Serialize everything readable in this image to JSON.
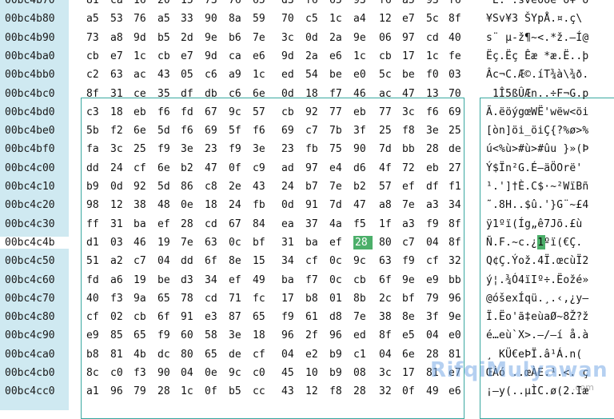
{
  "rows": [
    {
      "offset": "00bc4b70",
      "hex": [
        "81",
        "ca",
        "16",
        "20",
        "15",
        "73",
        "76",
        "65",
        "d3",
        "f6",
        "65",
        "93",
        "f6",
        "a5",
        "93",
        "f6"
      ],
      "ascii": " Ê. .sveÓöe\"ö¥\"ö"
    },
    {
      "offset": "00bc4b80",
      "hex": [
        "a5",
        "53",
        "76",
        "a5",
        "33",
        "90",
        "8a",
        "59",
        "70",
        "c5",
        "1c",
        "a4",
        "12",
        "e7",
        "5c",
        "8f"
      ],
      "ascii": "¥Sv¥3 ŠYpÅ.¤.ç\\"
    },
    {
      "offset": "00bc4b90",
      "hex": [
        "73",
        "a8",
        "9d",
        "b5",
        "2d",
        "9e",
        "b6",
        "7e",
        "3c",
        "0d",
        "2a",
        "9e",
        "06",
        "97",
        "cd",
        "40"
      ],
      "ascii": "s¨ µ-ž¶~<.*ž.—Í@"
    },
    {
      "offset": "00bc4ba0",
      "hex": [
        "cb",
        "e7",
        "1c",
        "cb",
        "e7",
        "9d",
        "ca",
        "e6",
        "9d",
        "2a",
        "e6",
        "1c",
        "cb",
        "17",
        "1c",
        "fe"
      ],
      "ascii": "Ëç.Ëç Êæ *æ.Ë..þ"
    },
    {
      "offset": "00bc4bb0",
      "hex": [
        "c2",
        "63",
        "ac",
        "43",
        "05",
        "c6",
        "a9",
        "1c",
        "ed",
        "54",
        "be",
        "e0",
        "5c",
        "be",
        "f0",
        "03"
      ],
      "ascii": "Âc¬C.Æ©.íT¾à\\¾ð."
    },
    {
      "offset": "00bc4bc0",
      "hex": [
        "8f",
        "31",
        "ce",
        "35",
        "df",
        "db",
        "c6",
        "6e",
        "0d",
        "18",
        "f7",
        "46",
        "ac",
        "47",
        "13",
        "70"
      ],
      "ascii": " 1Î5ßÛÆn..÷F¬G.p"
    },
    {
      "offset": "00bc4bd0",
      "hex": [
        "c3",
        "18",
        "eb",
        "f6",
        "fd",
        "67",
        "9c",
        "57",
        "cb",
        "92",
        "77",
        "eb",
        "77",
        "3c",
        "f6",
        "69"
      ],
      "ascii": "Ã.ëöýgœWË'wëw<öi"
    },
    {
      "offset": "00bc4be0",
      "hex": [
        "5b",
        "f2",
        "6e",
        "5d",
        "f6",
        "69",
        "5f",
        "f6",
        "69",
        "c7",
        "7b",
        "3f",
        "25",
        "f8",
        "3e",
        "25"
      ],
      "ascii": "[òn]öi_öiÇ{?%ø>%"
    },
    {
      "offset": "00bc4bf0",
      "hex": [
        "fa",
        "3c",
        "25",
        "f9",
        "3e",
        "23",
        "f9",
        "3e",
        "23",
        "fb",
        "75",
        "90",
        "7d",
        "bb",
        "28",
        "de"
      ],
      "ascii": "ú<%ù>#ù>#ûu }»(Þ"
    },
    {
      "offset": "00bc4c00",
      "hex": [
        "dd",
        "24",
        "cf",
        "6e",
        "b2",
        "47",
        "0f",
        "c9",
        "ad",
        "97",
        "e4",
        "d6",
        "4f",
        "72",
        "eb",
        "27"
      ],
      "ascii": "Ý$Ïn²G.É­—äÖOrë'"
    },
    {
      "offset": "00bc4c10",
      "hex": [
        "b9",
        "0d",
        "92",
        "5d",
        "86",
        "c8",
        "2e",
        "43",
        "24",
        "b7",
        "7e",
        "b2",
        "57",
        "ef",
        "df",
        "f1"
      ],
      "ascii": "¹.']†È.C$·~²WïBñ"
    },
    {
      "offset": "00bc4c20",
      "hex": [
        "98",
        "12",
        "38",
        "48",
        "0e",
        "18",
        "24",
        "fb",
        "0d",
        "91",
        "7d",
        "47",
        "a8",
        "7e",
        "a3",
        "34"
      ],
      "ascii": "˜.8H..$û.'}G¨~£4"
    },
    {
      "offset": "00bc4c30",
      "hex": [
        "ff",
        "31",
        "ba",
        "ef",
        "28",
        "cd",
        "67",
        "84",
        "ea",
        "37",
        "4a",
        "f5",
        "1f",
        "a3",
        "f9",
        "8f"
      ],
      "ascii": "ÿ1ºï(Íg„ê7Jõ.£ù "
    },
    {
      "offset": "00bc4c4b",
      "hex": [
        "d1",
        "03",
        "46",
        "19",
        "7e",
        "63",
        "0c",
        "bf",
        "31",
        "ba",
        "ef",
        "28",
        "80",
        "c7",
        "04",
        "8f"
      ],
      "ascii": "Ñ.F.~c.¿1ºï(€Ç. "
    },
    {
      "offset": "00bc4c50",
      "hex": [
        "51",
        "a2",
        "c7",
        "04",
        "dd",
        "6f",
        "8e",
        "15",
        "34",
        "cf",
        "0c",
        "9c",
        "63",
        "f9",
        "cf",
        "32"
      ],
      "ascii": "Q¢Ç.Ýož.4Ï.œcùÏ2"
    },
    {
      "offset": "00bc4c60",
      "hex": [
        "fd",
        "a6",
        "19",
        "be",
        "d3",
        "34",
        "ef",
        "49",
        "ba",
        "f7",
        "0c",
        "cb",
        "6f",
        "9e",
        "e9",
        "bb"
      ],
      "ascii": "ý¦.¾Ó4ïIº÷.Ëožé»"
    },
    {
      "offset": "00bc4c70",
      "hex": [
        "40",
        "f3",
        "9a",
        "65",
        "78",
        "cd",
        "71",
        "fc",
        "17",
        "b8",
        "01",
        "8b",
        "2c",
        "bf",
        "79",
        "96"
      ],
      "ascii": "@óšexÍqü.¸.‹,¿y–"
    },
    {
      "offset": "00bc4c80",
      "hex": [
        "cf",
        "02",
        "cb",
        "6f",
        "91",
        "e3",
        "87",
        "65",
        "f9",
        "61",
        "d8",
        "7e",
        "38",
        "8e",
        "3f",
        "9e"
      ],
      "ascii": "Ï.Ëo'ã‡eùaØ~8Ž?ž"
    },
    {
      "offset": "00bc4c90",
      "hex": [
        "e9",
        "85",
        "65",
        "f9",
        "60",
        "58",
        "3e",
        "18",
        "96",
        "2f",
        "96",
        "ed",
        "8f",
        "e5",
        "04",
        "e0"
      ],
      "ascii": "é…eù`X>.–/–í å.à"
    },
    {
      "offset": "00bc4ca0",
      "hex": [
        "b8",
        "81",
        "4b",
        "dc",
        "80",
        "65",
        "de",
        "cf",
        "04",
        "e2",
        "b9",
        "c1",
        "04",
        "6e",
        "28",
        "81"
      ],
      "ascii": "¸ KÜ€eÞÏ.â¹Á.n( "
    },
    {
      "offset": "00bc4cb0",
      "hex": [
        "8c",
        "c0",
        "f3",
        "90",
        "04",
        "0e",
        "9c",
        "c0",
        "45",
        "10",
        "b9",
        "08",
        "3c",
        "17",
        "81",
        "e7"
      ],
      "ascii": "ŒÀó ..œÀE.¹.<. ç"
    },
    {
      "offset": "00bc4cc0",
      "hex": [
        "a1",
        "96",
        "79",
        "28",
        "1c",
        "0f",
        "b5",
        "cc",
        "43",
        "12",
        "f8",
        "28",
        "32",
        "0f",
        "49",
        "e6"
      ],
      "ascii": "¡–y(..µÌC.ø(2.Iæ"
    }
  ],
  "active_offset_index": 13,
  "selected_cell": {
    "row": 13,
    "col": 11
  },
  "watermark": {
    "brand": "RifqiMulyawan",
    "sub": ".com"
  },
  "colors": {
    "offset_bg": "#cfe9f1",
    "selection_border": "#3aa8a0",
    "cursor": "#4caf6a"
  }
}
